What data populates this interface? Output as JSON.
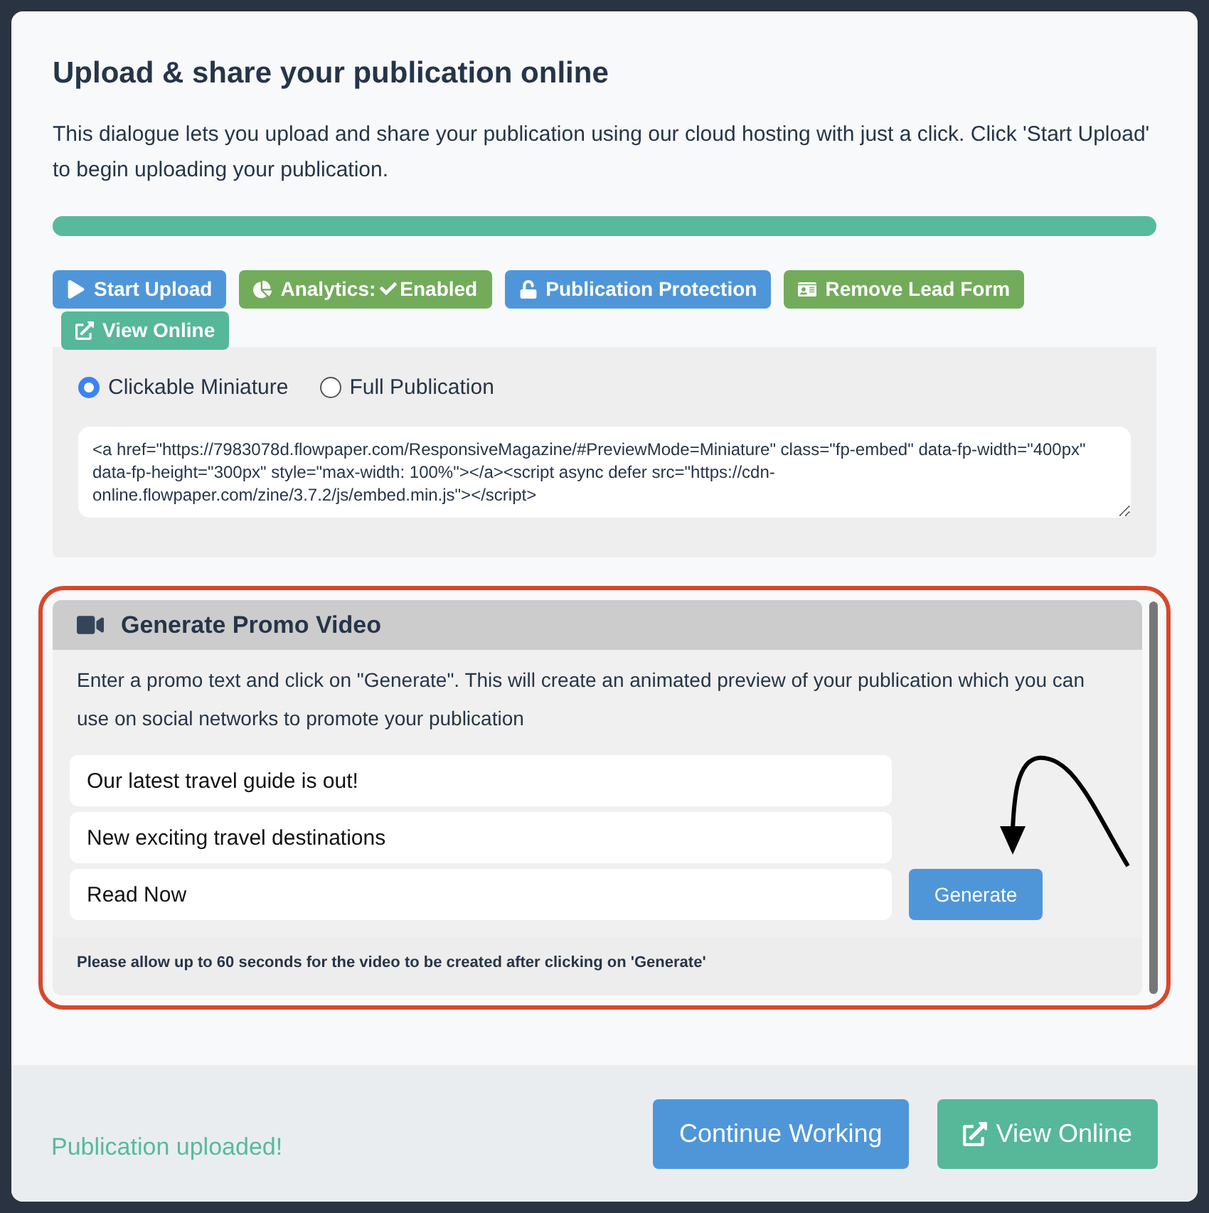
{
  "dialog": {
    "title": "Upload & share your publication online",
    "description": "This dialogue lets you upload and share your publication using our cloud hosting with just a click. Click 'Start Upload' to begin uploading your publication.",
    "progress": {
      "level": 1.0
    },
    "buttons": [
      {
        "kind": "play",
        "label": "Start Upload",
        "color": "#4f96d9"
      },
      {
        "kind": "chart",
        "label": "Analytics:",
        "suffix": "Enabled",
        "color": "#72ac5a"
      },
      {
        "kind": "lock",
        "label": "Publication Protection",
        "color": "#4f96d9"
      },
      {
        "kind": "card",
        "label": "Remove Lead Form",
        "color": "#72ac5a"
      },
      {
        "kind": "external",
        "label": "View Online",
        "color": "#56b898"
      }
    ],
    "embed": {
      "options": [
        {
          "label": "Clickable Miniature",
          "selected": true
        },
        {
          "label": "Full Publication",
          "selected": false
        }
      ],
      "code": "<a href=\"https://7983078d.flowpaper.com/ResponsiveMagazine/#PreviewMode=Miniature\" class=\"fp-embed\" data-fp-width=\"400px\" data-fp-height=\"300px\" style=\"max-width: 100%\"></a><script async defer src=\"https://cdn-online.flowpaper.com/zine/3.7.2/js/embed.min.js\"></script>"
    },
    "promo": {
      "title": "Generate Promo Video",
      "description": "Enter a promo text and click on \"Generate\". This will create an animated preview of your publication which you can use on social networks to promote your publication",
      "fields": [
        {
          "value": "Our latest travel guide is out!"
        },
        {
          "value": "New exciting travel destinations"
        },
        {
          "value": "Read Now"
        }
      ],
      "generate": "Generate",
      "note": "Please allow up to 60 seconds for the video to be created after clicking on 'Generate'"
    },
    "footer": {
      "status": "Publication uploaded!",
      "continue": "Continue Working",
      "view": "View Online"
    }
  }
}
